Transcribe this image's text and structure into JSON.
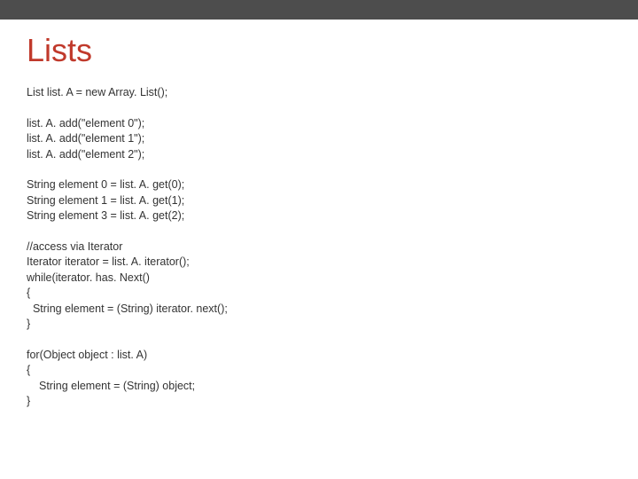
{
  "slide": {
    "title": "Lists",
    "code": {
      "l01": "List list. A = new Array. List();",
      "l02": "list. A. add(\"element 0\");",
      "l03": "list. A. add(\"element 1\");",
      "l04": "list. A. add(\"element 2\");",
      "l05": "String element 0 = list. A. get(0);",
      "l06": "String element 1 = list. A. get(1);",
      "l07": "String element 3 = list. A. get(2);",
      "l08": "//access via Iterator",
      "l09": "Iterator iterator = list. A. iterator();",
      "l10": "while(iterator. has. Next()",
      "l11": "{",
      "l12": "  String element = (String) iterator. next();",
      "l13": "}",
      "l14": "for(Object object : list. A)",
      "l15": "{",
      "l16": "String element = (String) object;",
      "l17": "}"
    }
  }
}
